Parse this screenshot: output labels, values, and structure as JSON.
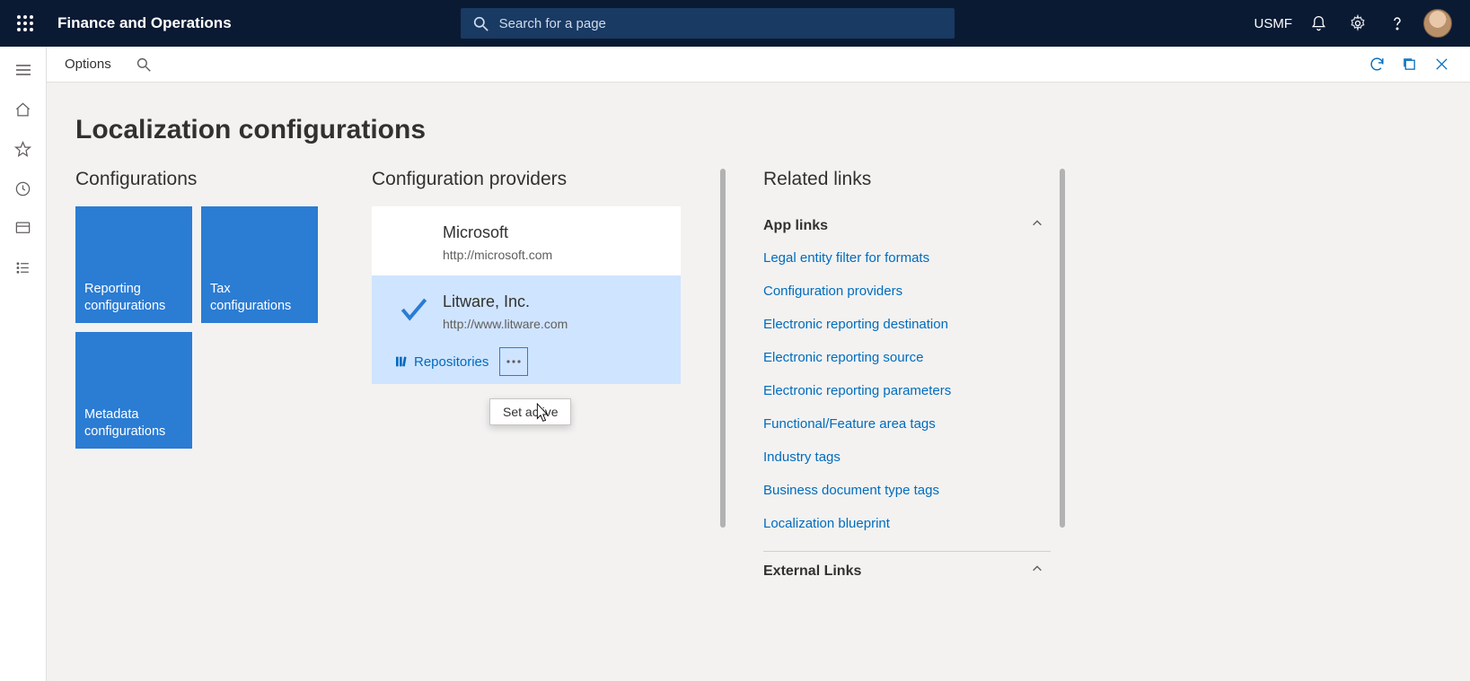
{
  "app": {
    "title": "Finance and Operations"
  },
  "search": {
    "placeholder": "Search for a page"
  },
  "company": "USMF",
  "cmdbar": {
    "options": "Options"
  },
  "page": {
    "title": "Localization configurations"
  },
  "sections": {
    "configs": "Configurations",
    "providers": "Configuration providers",
    "related": "Related links"
  },
  "tiles": [
    {
      "label": "Reporting configurations"
    },
    {
      "label": "Tax configurations"
    },
    {
      "label": "Metadata configurations"
    }
  ],
  "providers": [
    {
      "name": "Microsoft",
      "url": "http://microsoft.com",
      "active": false
    },
    {
      "name": "Litware, Inc.",
      "url": "http://www.litware.com",
      "active": true
    }
  ],
  "provider_actions": {
    "repositories": "Repositories",
    "menu_item": "Set active"
  },
  "related": {
    "app_links": {
      "title": "App links",
      "items": [
        "Legal entity filter for formats",
        "Configuration providers",
        "Electronic reporting destination",
        "Electronic reporting source",
        "Electronic reporting parameters",
        "Functional/Feature area tags",
        "Industry tags",
        "Business document type tags",
        "Localization blueprint"
      ]
    },
    "external_links": {
      "title": "External Links"
    }
  }
}
